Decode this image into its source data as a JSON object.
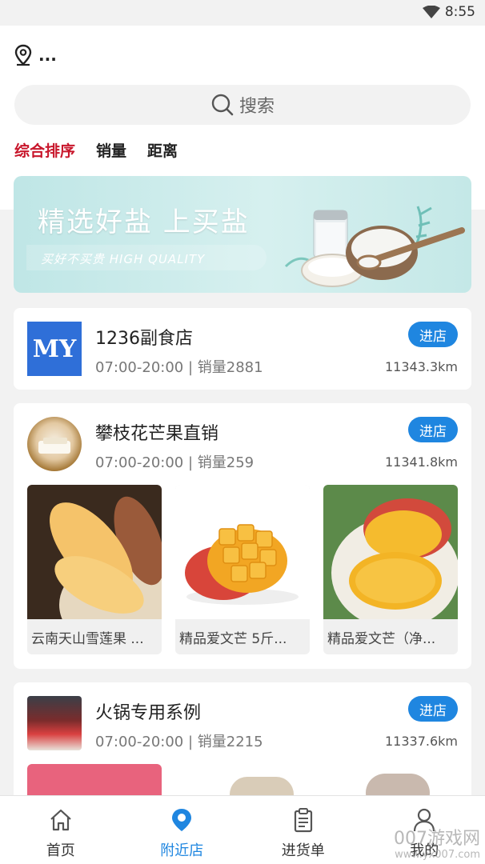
{
  "status": {
    "time": "8:55"
  },
  "location": {
    "text": "..."
  },
  "search": {
    "placeholder": "搜索"
  },
  "sort_tabs": [
    {
      "label": "综合排序",
      "active": true
    },
    {
      "label": "销量"
    },
    {
      "label": "距离"
    }
  ],
  "banner": {
    "title": "精选好盐 上买盐",
    "slogan": "买好不买贵 HIGH QUALITY"
  },
  "stores": [
    {
      "name": "1236副食店",
      "meta": "07:00-20:00 | 销量2881",
      "distance": "11343.3km",
      "enter_label": "进店",
      "logo_text": "MY"
    },
    {
      "name": "攀枝花芒果直销",
      "meta": "07:00-20:00 | 销量259",
      "distance": "11341.8km",
      "enter_label": "进店",
      "products": [
        {
          "name": "云南天山雪莲果 ..."
        },
        {
          "name": "精品爱文芒 5斤..."
        },
        {
          "name": "精品爱文芒（净..."
        }
      ]
    },
    {
      "name": "火锅专用系例",
      "meta": "07:00-20:00 | 销量2215",
      "distance": "11337.6km",
      "enter_label": "进店"
    }
  ],
  "bottom_nav": [
    {
      "label": "首页",
      "icon": "home-icon"
    },
    {
      "label": "附近店",
      "icon": "location-pin-icon",
      "active": true
    },
    {
      "label": "进货单",
      "icon": "clipboard-icon"
    },
    {
      "label": "我的",
      "icon": "user-icon"
    }
  ],
  "watermark": {
    "text": "007游戏网",
    "sub": "www.yx007.com"
  },
  "colors": {
    "accent": "#1f86e0",
    "active_sort": "#c8162b",
    "background": "#f2f2f2"
  }
}
